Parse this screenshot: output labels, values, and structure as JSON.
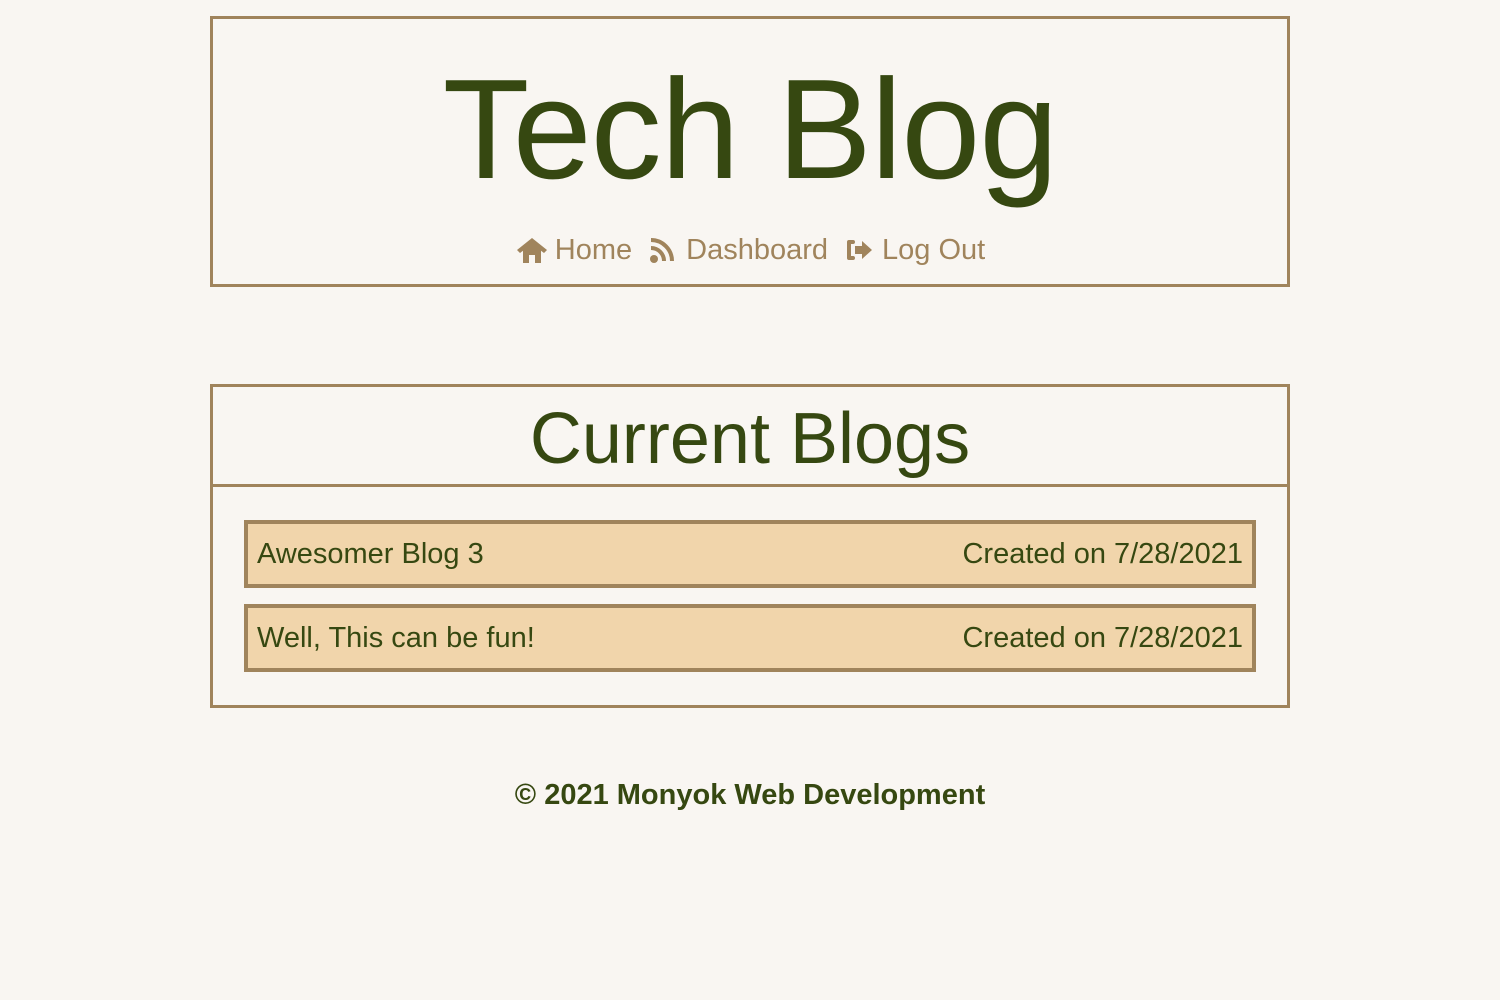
{
  "header": {
    "title": "Tech Blog",
    "nav": [
      {
        "icon": "home-icon",
        "label": "Home"
      },
      {
        "icon": "rss-icon",
        "label": "Dashboard"
      },
      {
        "icon": "logout-icon",
        "label": "Log Out"
      }
    ]
  },
  "main": {
    "heading": "Current Blogs",
    "posts": [
      {
        "title": "Awesomer Blog 3",
        "created_label": "Created on",
        "created_date": "7/28/2021"
      },
      {
        "title": "Well, This can be fun!",
        "created_label": "Created on",
        "created_date": "7/28/2021"
      }
    ]
  },
  "footer": {
    "text": "© 2021 Monyok Web Development"
  },
  "colors": {
    "background": "#f9f6f2",
    "accent": "#a0845c",
    "text": "#364811",
    "card": "#f1d5ab"
  }
}
